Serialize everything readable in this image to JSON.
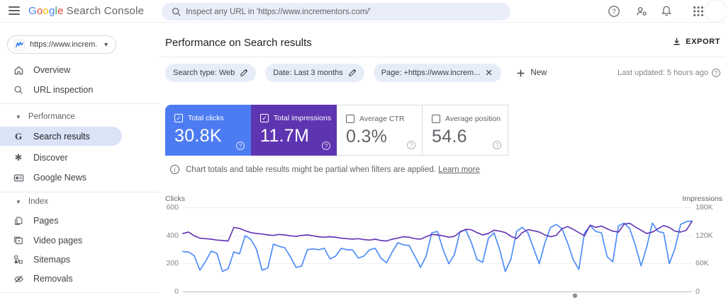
{
  "topbar": {
    "logo": {
      "brand": "Google",
      "product": "Search Console"
    },
    "search": {
      "placeholder": "Inspect any URL in 'https://www.incrementors.com/'"
    },
    "icons": [
      "help",
      "manage-users",
      "notifications",
      "apps-grid",
      "avatar"
    ]
  },
  "sidebar": {
    "property": {
      "label": "https://www.increm..."
    },
    "sections": [
      {
        "items": [
          {
            "label": "Overview",
            "icon": "home"
          },
          {
            "label": "URL inspection",
            "icon": "search"
          }
        ]
      },
      {
        "header": "Performance",
        "items": [
          {
            "label": "Search results",
            "icon": "google-g",
            "selected": true
          },
          {
            "label": "Discover",
            "icon": "discover"
          },
          {
            "label": "Google News",
            "icon": "news"
          }
        ]
      },
      {
        "header": "Index",
        "items": [
          {
            "label": "Pages",
            "icon": "pages"
          },
          {
            "label": "Video pages",
            "icon": "video-pages"
          },
          {
            "label": "Sitemaps",
            "icon": "sitemaps"
          },
          {
            "label": "Removals",
            "icon": "removals"
          }
        ]
      }
    ]
  },
  "main": {
    "title": "Performance on Search results",
    "export_label": "EXPORT",
    "filters": {
      "chips": [
        {
          "label": "Search type: Web",
          "action": "edit"
        },
        {
          "label": "Date: Last 3 months",
          "action": "edit"
        },
        {
          "label": "Page: +https://www.increm...",
          "action": "remove"
        }
      ],
      "new_label": "New"
    },
    "last_updated": "Last updated: 5 hours ago",
    "cards": [
      {
        "label": "Total clicks",
        "value": "30.8K",
        "selected": true,
        "bg": "#4d7cf2",
        "text_color": "#ffffff"
      },
      {
        "label": "Total impressions",
        "value": "11.7M",
        "selected": true,
        "bg": "#5e35b1",
        "text_color": "#ffffff"
      },
      {
        "label": "Average CTR",
        "value": "0.3%",
        "selected": false
      },
      {
        "label": "Average position",
        "value": "54.6",
        "selected": false
      }
    ],
    "notice": {
      "text": "Chart totals and table results might be partial when filters are applied.",
      "link": "Learn more"
    }
  },
  "colors": {
    "card_clicks_bg": "#4d7cf2",
    "card_impressions_bg": "#5e35b1",
    "line_clicks": "#4e8df7",
    "line_impressions": "#673ab7",
    "selected_nav_bg": "#dbe3f7",
    "chip_bg": "#e7edf8",
    "google_letters": [
      "#4285f4",
      "#ea4335",
      "#fbbc05",
      "#4285f4",
      "#34a853",
      "#ea4335"
    ]
  },
  "chart_data": {
    "type": "line",
    "x_unit": "day",
    "x_range": "Last 3 months (daily points)",
    "grid": true,
    "legend": "none",
    "left_axis": {
      "label": "Clicks",
      "ticks": [
        "600",
        "400",
        "200",
        "0"
      ],
      "min": 0,
      "max": 600
    },
    "right_axis": {
      "label": "Impressions",
      "ticks": [
        "180K",
        "120K",
        "60K",
        "0"
      ],
      "min": 0,
      "max": 180000
    },
    "series": [
      {
        "name": "Total clicks",
        "axis": "left",
        "color": "#4e8df7",
        "values": [
          285,
          282,
          255,
          152,
          215,
          288,
          272,
          143,
          162,
          283,
          268,
          398,
          372,
          302,
          152,
          168,
          338,
          322,
          312,
          248,
          172,
          182,
          298,
          304,
          298,
          308,
          232,
          252,
          308,
          298,
          296,
          238,
          252,
          298,
          308,
          238,
          205,
          282,
          348,
          332,
          328,
          252,
          172,
          252,
          418,
          428,
          298,
          198,
          262,
          428,
          438,
          348,
          228,
          208,
          378,
          418,
          298,
          142,
          232,
          428,
          458,
          418,
          308,
          198,
          348,
          458,
          478,
          448,
          348,
          228,
          158,
          418,
          468,
          428,
          418,
          248,
          212,
          468,
          488,
          448,
          328,
          182,
          318,
          488,
          428,
          418,
          198,
          308,
          478,
          498,
          502
        ]
      },
      {
        "name": "Total impressions",
        "axis": "right",
        "color": "#673ab7",
        "unit": "K",
        "values": [
          124,
          127,
          119,
          114,
          113,
          112,
          110,
          109,
          108,
          137,
          135,
          130,
          126,
          124,
          123,
          121,
          120,
          122,
          121,
          119,
          118,
          120,
          121,
          119,
          117,
          116,
          117,
          116,
          114,
          113,
          112,
          113,
          111,
          110,
          112,
          109,
          108,
          112,
          114,
          117,
          116,
          113,
          112,
          117,
          122,
          121,
          119,
          116,
          118,
          127,
          133,
          132,
          126,
          121,
          124,
          131,
          129,
          126,
          118,
          113,
          126,
          132,
          130,
          127,
          121,
          117,
          120,
          134,
          139,
          133,
          126,
          119,
          142,
          137,
          140,
          134,
          129,
          127,
          144,
          146,
          138,
          131,
          124,
          127,
          134,
          141,
          137,
          129,
          127,
          131,
          150
        ]
      }
    ]
  }
}
